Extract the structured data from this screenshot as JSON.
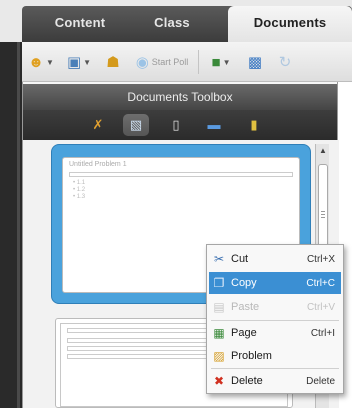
{
  "tabs": [
    {
      "label": "Content",
      "active": false
    },
    {
      "label": "Class",
      "active": false
    },
    {
      "label": "Documents",
      "active": true
    }
  ],
  "toolbar": {
    "start_poll_label": "Start Poll"
  },
  "toolbox": {
    "title": "Documents Toolbox",
    "tools": [
      "tools-icon",
      "page-sorter-icon",
      "handheld-icon",
      "book-icon",
      "folder-icon"
    ]
  },
  "document": {
    "thumb1_title": "Untitled Problem 1",
    "thumb1_items": [
      "• 1.1",
      "• 1.2",
      "• 1.3"
    ]
  },
  "context_menu": {
    "items": [
      {
        "label": "Cut",
        "shortcut": "Ctrl+X",
        "icon": "scissors-icon",
        "state": "normal"
      },
      {
        "label": "Copy",
        "shortcut": "Ctrl+C",
        "icon": "copy-icon",
        "state": "highlighted"
      },
      {
        "label": "Paste",
        "shortcut": "Ctrl+V",
        "icon": "paste-icon",
        "state": "disabled"
      },
      {
        "label": "Page",
        "shortcut": "Ctrl+I",
        "icon": "page-icon",
        "state": "normal"
      },
      {
        "label": "Problem",
        "shortcut": "",
        "icon": "problem-icon",
        "state": "normal"
      },
      {
        "label": "Delete",
        "shortcut": "Delete",
        "icon": "delete-icon",
        "state": "normal"
      }
    ]
  },
  "colors": {
    "highlight": "#3b8fd3",
    "selection_frame": "#4aa2dc",
    "tab_bar": "#4a4a4a"
  }
}
